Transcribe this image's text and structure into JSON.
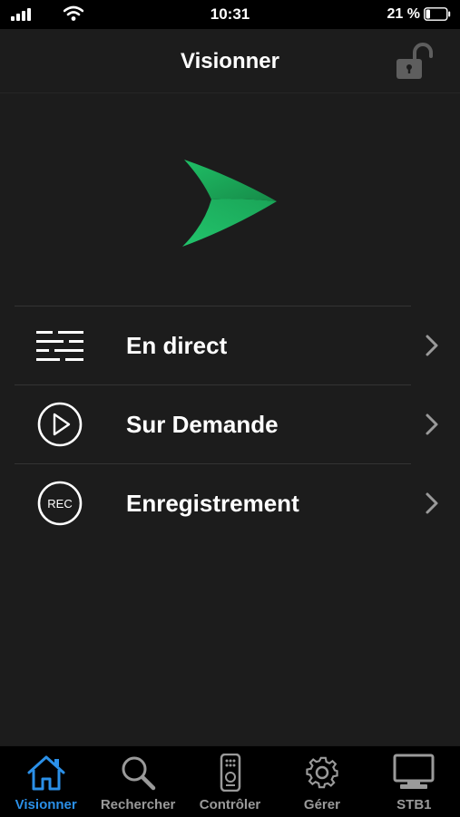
{
  "status_bar": {
    "time": "10:31",
    "battery_percent": "21 %",
    "battery_level": 0.21
  },
  "header": {
    "title": "Visionner",
    "lock_icon": "unlocked-padlock-icon"
  },
  "logo": {
    "icon": "green-arrow-logo",
    "color": "#1fad5a"
  },
  "menu": {
    "items": [
      {
        "label": "En direct",
        "icon": "guide-lines-icon"
      },
      {
        "label": "Sur Demande",
        "icon": "play-circle-icon"
      },
      {
        "label": "Enregistrement",
        "icon": "rec-circle-icon",
        "icon_text": "REC"
      }
    ]
  },
  "tabbar": {
    "active_color": "#2b90e8",
    "items": [
      {
        "label": "Visionner",
        "icon": "home-icon",
        "active": true
      },
      {
        "label": "Rechercher",
        "icon": "search-icon",
        "active": false
      },
      {
        "label": "Contrôler",
        "icon": "remote-control-icon",
        "active": false
      },
      {
        "label": "Gérer",
        "icon": "gear-icon",
        "active": false
      },
      {
        "label": "STB1",
        "icon": "tv-icon",
        "active": false
      }
    ]
  }
}
